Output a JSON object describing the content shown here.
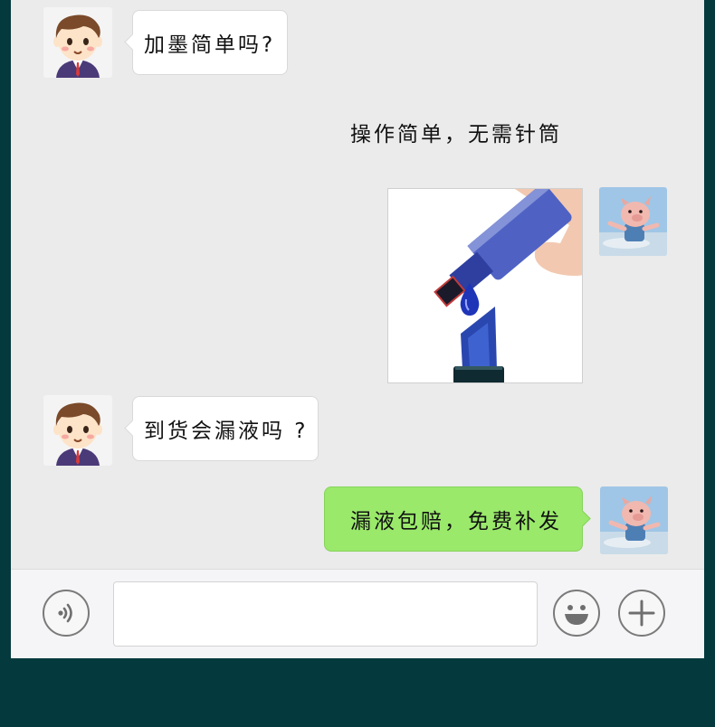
{
  "messages": [
    {
      "sender": "customer",
      "text": "加墨简单吗?"
    },
    {
      "sender": "seller",
      "text": "操作简单，无需针筒"
    },
    {
      "sender": "seller",
      "image": "ink-refill-photo"
    },
    {
      "sender": "customer",
      "text": "到货会漏液吗 ?"
    },
    {
      "sender": "seller",
      "text": "漏液包赔，免费补发"
    }
  ],
  "input_bar": {
    "voice_icon": "voice-icon",
    "emoji_icon": "emoji-icon",
    "plus_icon": "plus-icon",
    "input_value": ""
  },
  "colors": {
    "frame": "#043a3d",
    "chat_background": "#ebebeb",
    "green_bubble": "#9ae96b",
    "ink_blue": "#1f35b8"
  }
}
